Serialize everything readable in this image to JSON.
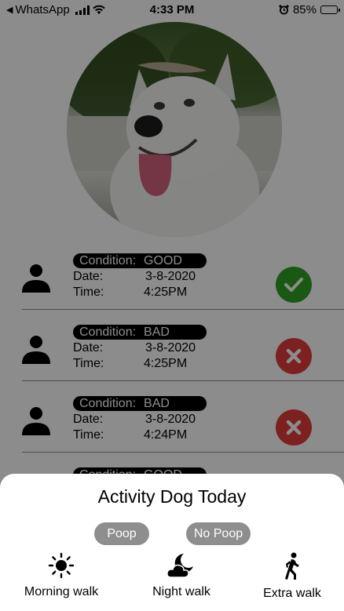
{
  "status_bar": {
    "back_app": "WhatsApp",
    "time": "4:33 PM",
    "battery": "85%",
    "battery_level": 0.85
  },
  "activity_list": [
    {
      "condition_label": "Condition:",
      "condition_value": "GOOD",
      "date_label": "Date:",
      "date_value": "3-8-2020",
      "time_label": "Time:",
      "time_value": "4:25PM",
      "status": "good"
    },
    {
      "condition_label": "Condition:",
      "condition_value": "BAD",
      "date_label": "Date:",
      "date_value": "3-8-2020",
      "time_label": "Time:",
      "time_value": "4:25PM",
      "status": "bad"
    },
    {
      "condition_label": "Condition:",
      "condition_value": "BAD",
      "date_label": "Date:",
      "date_value": "3-8-2020",
      "time_label": "Time:",
      "time_value": "4:24PM",
      "status": "bad"
    },
    {
      "condition_label": "Condition:",
      "condition_value": "GOOD"
    }
  ],
  "sheet": {
    "title": "Activity Dog Today",
    "chips": [
      "Poop",
      "No Poop"
    ],
    "actions": [
      {
        "label": "Morning walk",
        "icon": "sun-icon"
      },
      {
        "label": "Night walk",
        "icon": "moon-cloud-icon"
      },
      {
        "label": "Extra walk",
        "icon": "walking-person-icon"
      }
    ]
  },
  "colors": {
    "good": "#2ea326",
    "bad": "#e23b3b",
    "chip": "#8e8e8e"
  }
}
